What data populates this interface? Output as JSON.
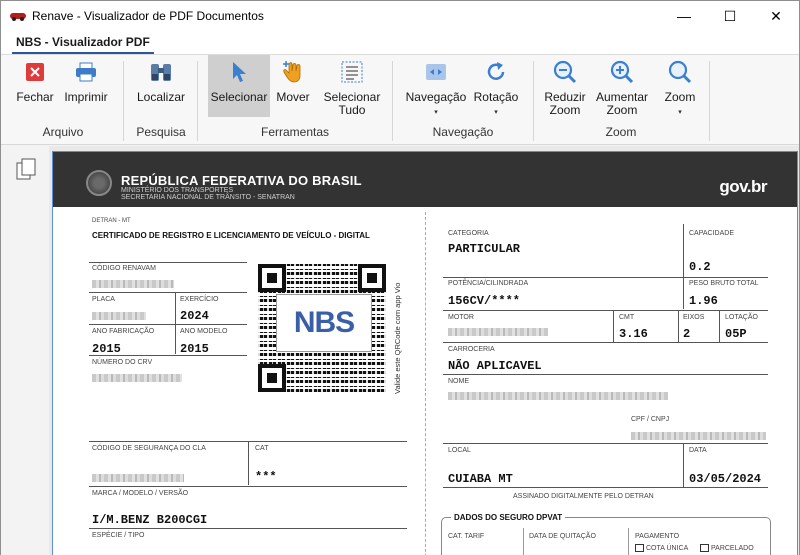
{
  "window": {
    "title": "Renave - Visualizador de PDF  Documentos",
    "minimize": "—",
    "maximize": "☐",
    "close": "✕"
  },
  "ribbon": {
    "tab": "NBS - Visualizador PDF",
    "buttons": {
      "fechar": "Fechar",
      "imprimir": "Imprimir",
      "localizar": "Localizar",
      "selecionar": "Selecionar",
      "mover": "Mover",
      "selecionar_tudo_1": "Selecionar",
      "selecionar_tudo_2": "Tudo",
      "navegacao": "Navegação",
      "rotacao": "Rotação",
      "reduzir_1": "Reduzir",
      "reduzir_2": "Zoom",
      "aumentar_1": "Aumentar",
      "aumentar_2": "Zoom",
      "zoom": "Zoom"
    },
    "groups": {
      "arquivo": "Arquivo",
      "pesquisa": "Pesquisa",
      "ferramentas": "Ferramentas",
      "navegacao": "Navegação",
      "zoom": "Zoom"
    },
    "caret": "▾"
  },
  "doc": {
    "header": {
      "republica": "REPÚBLICA FEDERATIVA DO BRASIL",
      "ministerio": "MINISTÉRIO DOS TRANSPORTES",
      "secretaria": "SECRETARIA NACIONAL DE TRÂNSITO - SENATRAN",
      "govbr": "gov.br"
    },
    "detran": "DETRAN - MT",
    "cert_title": "CERTIFICADO DE REGISTRO E LICENCIAMENTO DE VEÍCULO - DIGITAL",
    "labels": {
      "renavam": "CÓDIGO RENAVAM",
      "placa": "PLACA",
      "exercicio": "EXERCÍCIO",
      "ano_fab": "ANO FABRICAÇÃO",
      "ano_modelo": "ANO MODELO",
      "num_crv": "NÚMERO DO CRV",
      "cod_seg": "CÓDIGO DE SEGURANÇA DO CLA",
      "cat": "CAT",
      "marca": "MARCA / MODELO / VERSÃO",
      "especie": "ESPÉCIE / TIPO",
      "categoria": "CATEGORIA",
      "capacidade": "CAPACIDADE",
      "potencia": "POTÊNCIA/CILINDRADA",
      "peso": "PESO BRUTO TOTAL",
      "motor": "MOTOR",
      "cmt": "CMT",
      "eixos": "EIXOS",
      "lotacao": "LOTAÇÃO",
      "carroceria": "CARROCERIA",
      "nome": "NOME",
      "cpf": "CPF / CNPJ",
      "local": "LOCAL",
      "data": "DATA",
      "assinado": "ASSINADO DIGITALMENTE PELO DETRAN",
      "dpvat": "DADOS DO SEGURO DPVAT",
      "cat_tarif": "CAT. TARIF",
      "data_quit": "DATA DE QUITAÇÃO",
      "pagamento": "PAGAMENTO",
      "cota_unica": "COTA ÚNICA",
      "parcelado": "PARCELADO",
      "qr_side": "Valide este QRCode com app Vio"
    },
    "values": {
      "exercicio": "2024",
      "ano_fab": "2015",
      "ano_modelo": "2015",
      "cat": "***",
      "marca": "I/M.BENZ B200CGI",
      "categoria": "PARTICULAR",
      "capacidade": "0.2",
      "potencia": "156CV/****",
      "peso": "1.96",
      "cmt": "3.16",
      "eixos": "2",
      "lotacao": "05P",
      "carroceria": "NÃO APLICAVEL",
      "local": "CUIABA MT",
      "data": "03/05/2024",
      "nbs": "NBS"
    }
  }
}
